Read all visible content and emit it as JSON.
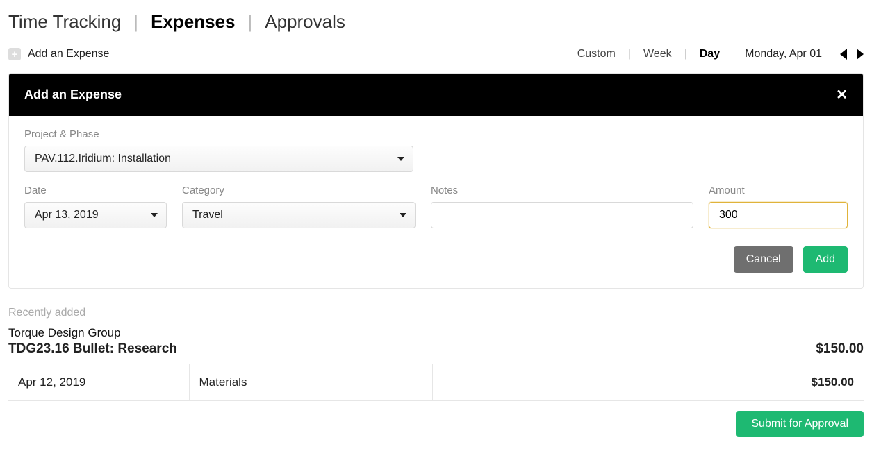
{
  "nav": {
    "tabs": [
      "Time Tracking",
      "Expenses",
      "Approvals"
    ],
    "activeIndex": 1
  },
  "subbar": {
    "addLabel": "Add an Expense",
    "rangeOptions": [
      "Custom",
      "Week",
      "Day"
    ],
    "activeRangeIndex": 2,
    "date": "Monday, Apr 01"
  },
  "modal": {
    "title": "Add an Expense",
    "labels": {
      "projectPhase": "Project & Phase",
      "date": "Date",
      "category": "Category",
      "notes": "Notes",
      "amount": "Amount"
    },
    "values": {
      "projectPhase": "PAV.112.Iridium: Installation",
      "date": "Apr 13, 2019",
      "category": "Travel",
      "notes": "",
      "amount": "300"
    },
    "buttons": {
      "cancel": "Cancel",
      "add": "Add"
    }
  },
  "recent": {
    "heading": "Recently added",
    "company": "Torque Design Group",
    "project": "TDG23.16 Bullet: Research",
    "total": "$150.00",
    "rows": [
      {
        "date": "Apr 12, 2019",
        "category": "Materials",
        "notes": "",
        "amount": "$150.00"
      }
    ]
  },
  "footer": {
    "submit": "Submit for Approval"
  }
}
